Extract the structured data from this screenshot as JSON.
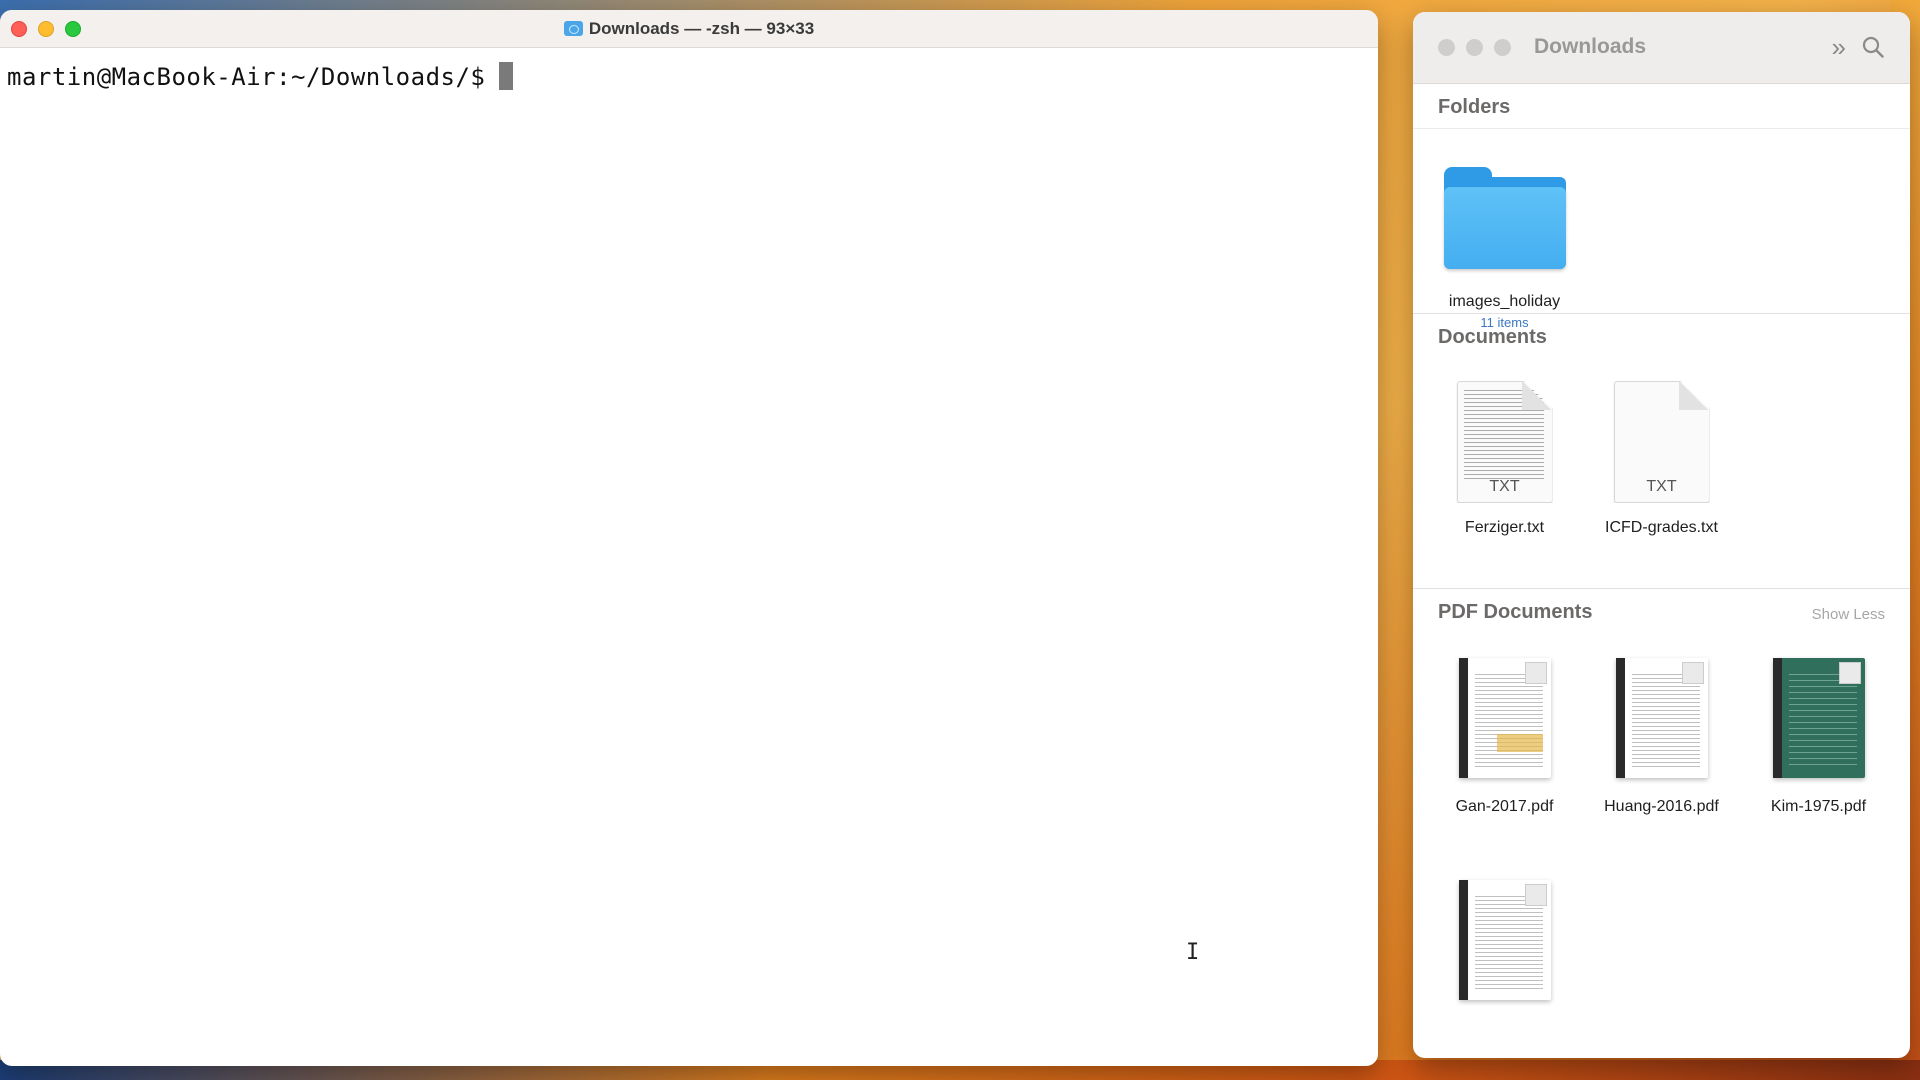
{
  "terminal": {
    "title": "Downloads — -zsh — 93×33",
    "prompt": "martin@MacBook-Air:~/Downloads/$"
  },
  "finder": {
    "title": "Downloads",
    "sections": {
      "folders": {
        "title": "Folders",
        "items": [
          {
            "name": "images_holiday",
            "sub": "11 items"
          }
        ]
      },
      "documents": {
        "title": "Documents",
        "items": [
          {
            "name": "Ferziger.txt",
            "badge": "TXT"
          },
          {
            "name": "ICFD-grades.txt",
            "badge": "TXT"
          }
        ]
      },
      "pdfs": {
        "title": "PDF Documents",
        "toggle": "Show Less",
        "items": [
          {
            "name": "Gan-2017.pdf"
          },
          {
            "name": "Huang-2016.pdf"
          },
          {
            "name": "Kim-1975.pdf"
          }
        ]
      }
    }
  },
  "colors": {
    "close": "#fe5f57",
    "minimize": "#febc2e",
    "zoom": "#28c840",
    "folder": "#44aef0",
    "link": "#3b78c2"
  }
}
